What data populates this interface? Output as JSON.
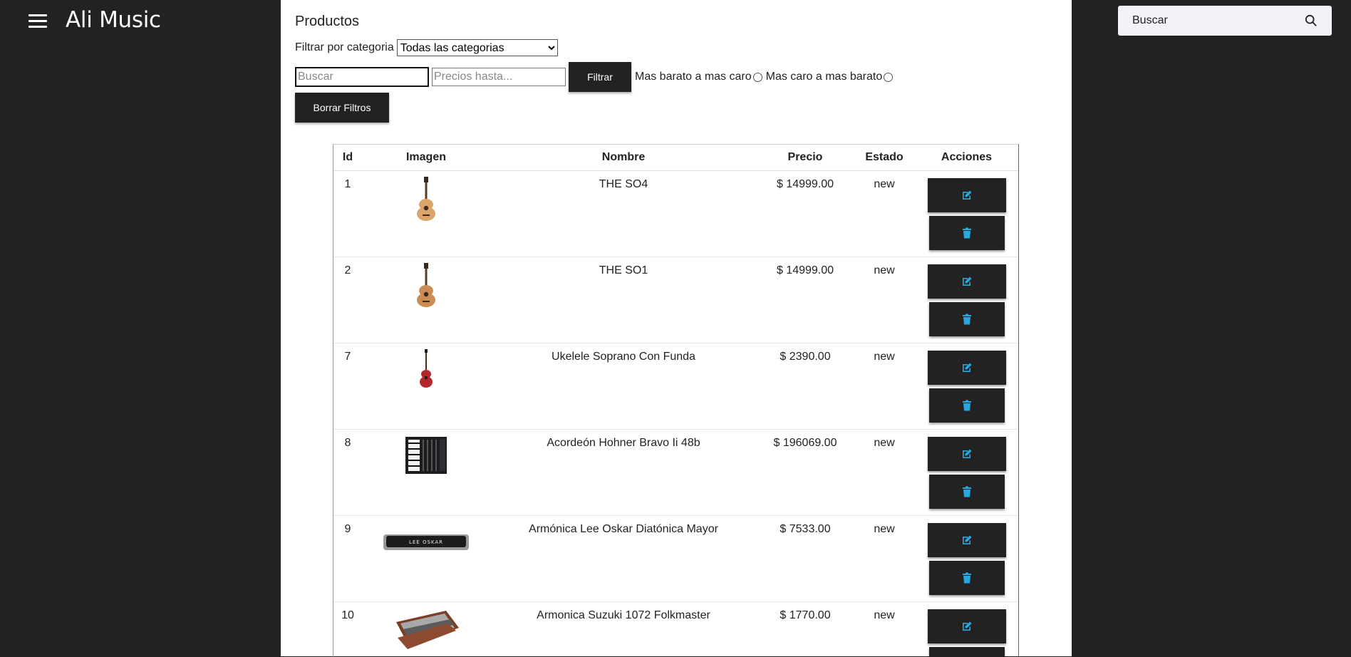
{
  "brand": "Ali Music",
  "top_search": {
    "placeholder": "Buscar"
  },
  "page_title": "Productos",
  "filter": {
    "category_label": "Filtrar por categoria",
    "category_selected": "Todas las categorias",
    "search_placeholder": "Buscar",
    "price_placeholder": "Precios hasta...",
    "filter_button": "Filtrar",
    "sort_asc_label": "Mas barato a mas caro",
    "sort_desc_label": "Mas caro a mas barato",
    "clear_button": "Borrar Filtros"
  },
  "table": {
    "headers": [
      "Id",
      "Imagen",
      "Nombre",
      "Precio",
      "Estado",
      "Acciones"
    ],
    "rows": [
      {
        "id": "1",
        "name": "THE SO4",
        "price": "$ 14999.00",
        "state": "new",
        "image": "guitar"
      },
      {
        "id": "2",
        "name": "THE SO1",
        "price": "$ 14999.00",
        "state": "new",
        "image": "guitar"
      },
      {
        "id": "7",
        "name": "Ukelele Soprano Con Funda",
        "price": "$ 2390.00",
        "state": "new",
        "image": "ukulele"
      },
      {
        "id": "8",
        "name": "Acordeón Hohner Bravo Ii 48b",
        "price": "$ 196069.00",
        "state": "new",
        "image": "accordion"
      },
      {
        "id": "9",
        "name": "Armónica Lee Oskar Diatónica Mayor",
        "price": "$ 7533.00",
        "state": "new",
        "image": "harmonica",
        "image_text": "LEE OSKAR"
      },
      {
        "id": "10",
        "name": "Armonica Suzuki 1072 Folkmaster",
        "price": "$ 1770.00",
        "state": "new",
        "image": "harmonica-case"
      }
    ]
  },
  "colors": {
    "sidebar_bg": "#222222",
    "panel_bg": "#ffffff",
    "button_bg": "#222222",
    "icon_accent": "#29a8e0"
  },
  "icons": {
    "menu": "hamburger-icon",
    "search": "search-icon",
    "edit": "edit-icon",
    "delete": "trash-icon"
  }
}
